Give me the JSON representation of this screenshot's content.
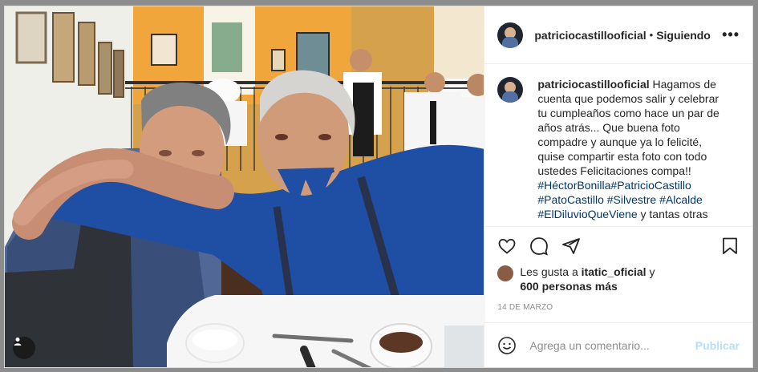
{
  "post": {
    "username": "patriciocastillooficial",
    "separator": "•",
    "follow_status": "Siguiendo",
    "more": "•••",
    "caption_text": "Hagamos de cuenta que podemos salir y celebrar tu cumpleaños como hace un par de años atrás... Que buena foto compadre y aunque ya lo felicité, quise compartir esta foto con todo ustedes Felicitaciones compa!!",
    "hashtags": [
      "#HéctorBonilla",
      "#PatricioCastillo",
      "#PatoCastillo",
      "#Silvestre",
      "#Alcalde",
      "#ElDiluvioQueViene"
    ],
    "caption_tail": " y tantas otras",
    "likes_prefix": "Les gusta a ",
    "likes_user": "itatic_oficial",
    "likes_connector": " y",
    "likes_count": "600 personas más",
    "date": "14 DE MARZO",
    "comment_placeholder": "Agrega un comentario...",
    "publish_label": "Publicar"
  }
}
